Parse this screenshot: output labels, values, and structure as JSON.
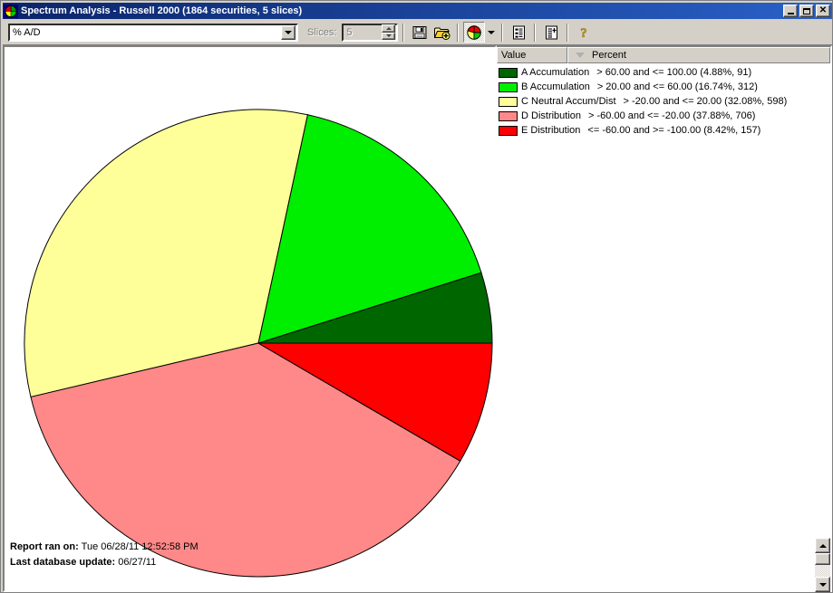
{
  "window": {
    "title": "Spectrum Analysis - Russell 2000 (1864 securities, 5 slices)",
    "icon": "pie-chart-icon",
    "minimize_label": "",
    "maximize_label": "",
    "close_label": "✕"
  },
  "toolbar": {
    "indicator_select": {
      "value": "% A/D",
      "icon": "chevron-down-icon"
    },
    "slices_label": "Slices:",
    "slices_value": "5",
    "buttons": [
      {
        "name": "save-button",
        "icon": "floppy-disk-icon",
        "label": "Save"
      },
      {
        "name": "open-button",
        "icon": "open-folder-add-icon",
        "label": "Open"
      },
      {
        "name": "pie-chart-view-button",
        "icon": "pie-chart-icon",
        "label": "Pie Chart"
      },
      {
        "name": "pie-chart-dropdown",
        "icon": "chevron-down-icon",
        "label": "More chart types"
      },
      {
        "name": "list-view-button",
        "icon": "list-report-icon",
        "label": "List View"
      },
      {
        "name": "detail-report-button",
        "icon": "detail-report-icon",
        "label": "Detail Report"
      },
      {
        "name": "help-button",
        "icon": "question-mark-icon",
        "label": "Help"
      }
    ]
  },
  "legend": {
    "columns": [
      "Value",
      "Percent"
    ],
    "sort_indicator": "descending",
    "rows": [
      {
        "swatch": "#006600",
        "name": "A Accumulation",
        "range": "> 60.00 and <= 100.00 (4.88%, 91)"
      },
      {
        "swatch": "#00ee00",
        "name": "B Accumulation",
        "range": "> 20.00 and <= 60.00 (16.74%, 312)"
      },
      {
        "swatch": "#ffff99",
        "name": "C Neutral Accum/Dist",
        "range": "> -20.00 and <= 20.00 (32.08%, 598)"
      },
      {
        "swatch": "#ff8888",
        "name": "D Distribution",
        "range": "> -60.00 and <= -20.00 (37.88%, 706)"
      },
      {
        "swatch": "#ff0000",
        "name": "E Distribution",
        "range": "<= -60.00 and >= -100.00 (8.42%, 157)"
      }
    ]
  },
  "footer": {
    "report_ran_label": "Report ran on:",
    "report_ran_value": "Tue 06/28/11 12:52:58 PM",
    "last_update_label": "Last database update:",
    "last_update_value": "06/27/11"
  },
  "chart_data": {
    "type": "pie",
    "title": "Spectrum Analysis - Russell 2000",
    "total_securities": 1864,
    "slice_count": 5,
    "start_angle_deg": 0,
    "direction": "counterclockwise",
    "center": [
      280,
      327
    ],
    "radius": 258,
    "labels": [
      "A Accumulation",
      "B Accumulation",
      "C Neutral Accum/Dist",
      "D Distribution",
      "E Distribution"
    ],
    "values": [
      4.88,
      16.74,
      32.08,
      37.88,
      8.42
    ],
    "counts": [
      91,
      312,
      598,
      706,
      157
    ],
    "colors": [
      "#006600",
      "#00ee00",
      "#ffff99",
      "#ff8888",
      "#ff0000"
    ],
    "ranges": [
      "> 60.00 and <= 100.00",
      "> 20.00 and <= 60.00",
      "> -20.00 and <= 20.00",
      "> -60.00 and <= -20.00",
      "<= -60.00 and >= -100.00"
    ],
    "ylabel": "",
    "xlabel": "",
    "legend_position": "right"
  }
}
